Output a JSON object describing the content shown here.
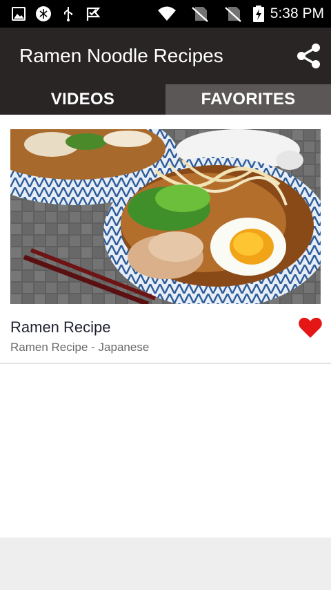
{
  "status_bar": {
    "time": "5:38 PM",
    "icons": [
      "image-icon",
      "sync-icon",
      "usb-icon",
      "check-flag-icon",
      "wifi-icon",
      "no-sim-icon",
      "no-sim-icon",
      "battery-charging-icon"
    ]
  },
  "app_bar": {
    "title": "Ramen Noodle Recipes",
    "share_icon": "share-icon"
  },
  "tabs": [
    {
      "label": "VIDEOS",
      "active": true
    },
    {
      "label": "FAVORITES",
      "active": false
    }
  ],
  "list": [
    {
      "title": "Ramen Recipe",
      "subtitle": "Ramen Recipe - Japanese",
      "favorite": true,
      "favorite_icon": "heart-icon"
    }
  ],
  "colors": {
    "status_bar": "#000000",
    "app_bar": "#2a2525",
    "tab_active": "#2a2525",
    "tab_inactive": "#5c5757",
    "favorite": "#e51616",
    "footer": "#eeeeee"
  }
}
